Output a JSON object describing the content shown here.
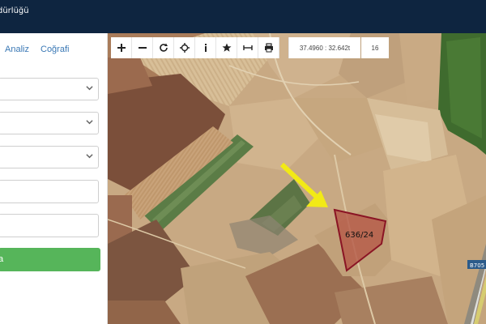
{
  "header": {
    "title": "dürlüğü"
  },
  "sidebar": {
    "tabs": [
      {
        "label": "Analiz"
      },
      {
        "label": "Coğrafi"
      }
    ],
    "button_label": "a"
  },
  "toolbar": {
    "coordinates": "37.4960 : 32.642t",
    "zoom_level": "16"
  },
  "map": {
    "parcel_label": "636/24",
    "road_label": "B705"
  },
  "colors": {
    "header_bg": "#0e2540",
    "button_green": "#56b55a",
    "parcel_outline": "#8a1424",
    "arrow": "#f2ea16"
  }
}
